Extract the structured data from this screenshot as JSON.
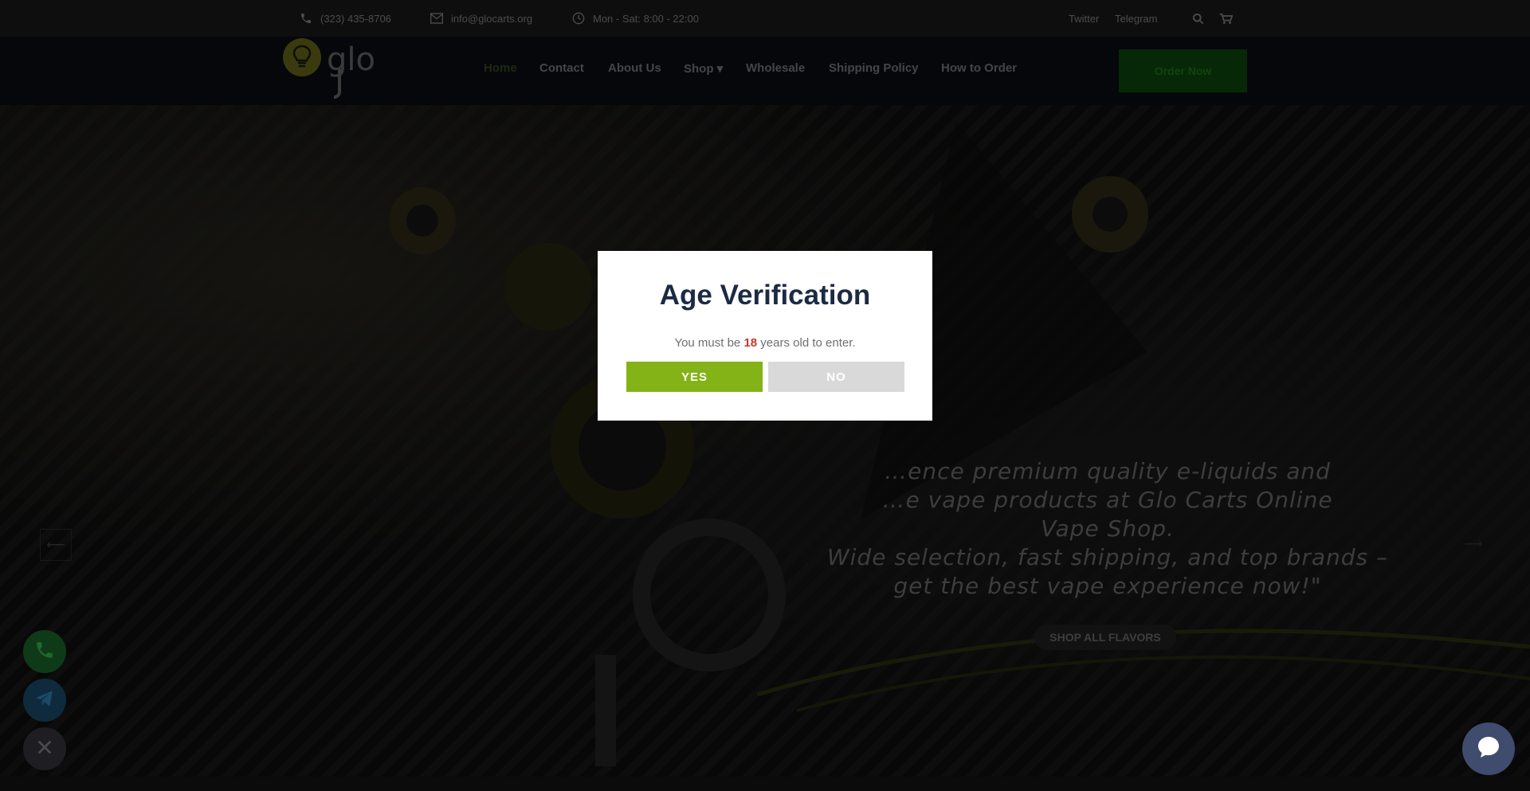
{
  "topbar": {
    "phone": "(323) 435-8706",
    "email": "info@glocarts.org",
    "hours": "Mon - Sat: 8:00 - 22:00",
    "social": [
      "Twitter",
      "Telegram"
    ]
  },
  "header": {
    "logo_text": "glo",
    "nav": [
      {
        "label": "Home",
        "active": true
      },
      {
        "label": "Contact"
      },
      {
        "label": "About Us"
      },
      {
        "label": "Shop ▾"
      },
      {
        "label": "Wholesale"
      },
      {
        "label": "Shipping Policy"
      },
      {
        "label": "How to Order"
      }
    ],
    "order_button": "Order Now"
  },
  "hero": {
    "line1": "…ence premium quality e-liquids and",
    "line2": "…e vape products at Glo Carts Online",
    "line3": "Vape Shop.",
    "line4": "Wide selection, fast shipping, and top brands –",
    "line5": "get the best vape experience now!\"",
    "cta": "SHOP ALL FLAVORS",
    "prev_arrow": "⟵",
    "next_arrow": "⟶"
  },
  "modal": {
    "title": "Age Verification",
    "msg_before": "You must be ",
    "age": "18",
    "msg_after": " years old to enter.",
    "yes": "YES",
    "no": "NO"
  },
  "colors": {
    "accent_green": "#84b317",
    "title_navy": "#1d2a44",
    "age_red": "#c0392b",
    "chat_button": "#3f4c6e"
  }
}
